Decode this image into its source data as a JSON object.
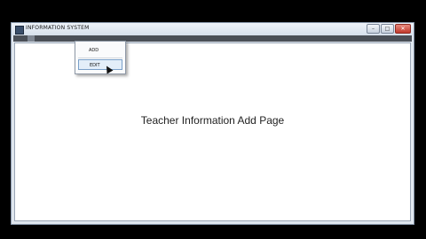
{
  "window": {
    "title": "INFORMATION SYSTEM",
    "controls": {
      "minimize": "–",
      "maximize": "□",
      "close": "✕"
    },
    "icon": "app-icon"
  },
  "menubar": {
    "items": [
      "",
      "",
      "",
      "",
      "",
      ""
    ],
    "active_index": 2
  },
  "dropdown": {
    "items": [
      {
        "label": "ADD"
      },
      {
        "label": "EDIT"
      }
    ],
    "hovered_index": 1
  },
  "content": {
    "heading": "Teacher Information Add Page"
  },
  "colors": {
    "menubar": "#4a4f57",
    "client_bg": "#ffffff",
    "close_button": "#c0392b"
  }
}
